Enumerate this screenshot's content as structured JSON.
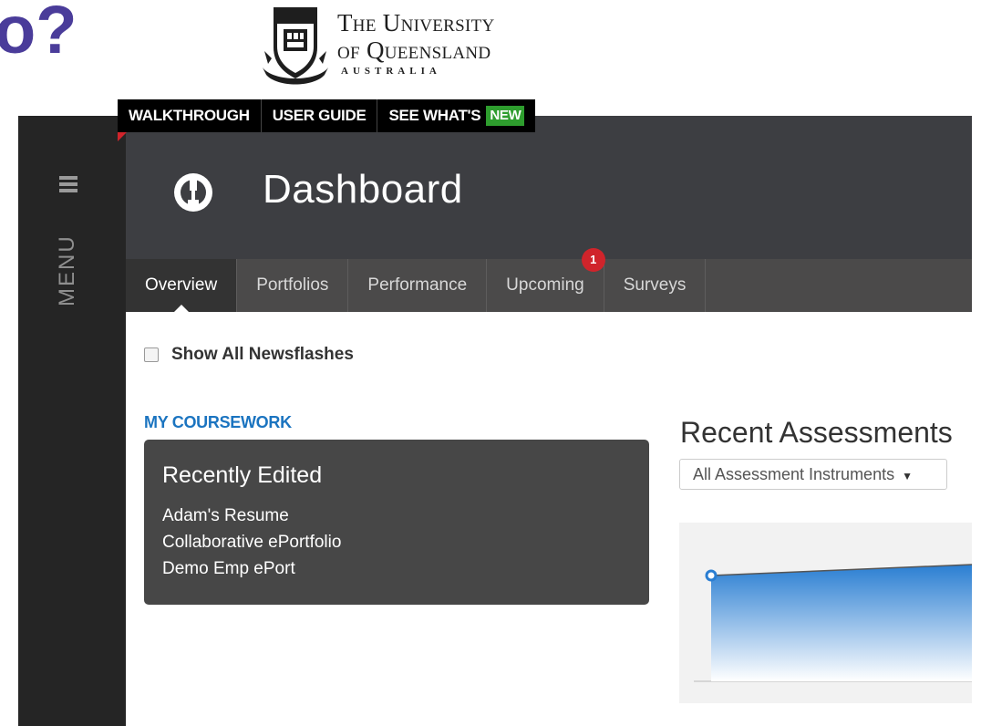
{
  "slide": {
    "title_fragment": "o?"
  },
  "university": {
    "line1": "The University",
    "line2": "of Queensland",
    "line3": "AUSTRALIA"
  },
  "topnav": {
    "walkthrough": "WALKTHROUGH",
    "user_guide": "USER GUIDE",
    "whats_new": "SEE WHAT'S",
    "new_badge": "NEW"
  },
  "sidebar": {
    "menu_label": "MENU"
  },
  "header": {
    "title": "Dashboard"
  },
  "tabs": [
    {
      "label": "Overview",
      "active": true
    },
    {
      "label": "Portfolios"
    },
    {
      "label": "Performance"
    },
    {
      "label": "Upcoming",
      "badge": "1"
    },
    {
      "label": "Surveys"
    }
  ],
  "newsflash": {
    "label": "Show All Newsflashes",
    "checked": false
  },
  "coursework": {
    "heading": "MY COURSEWORK",
    "card_title": "Recently Edited",
    "items": [
      "Adam's Resume",
      "Collaborative ePortfolio",
      "Demo Emp ePort"
    ]
  },
  "recent_assessments": {
    "title": "Recent Assessments",
    "filter": "All Assessment Instruments"
  },
  "colors": {
    "brand_purple": "#4a3c9a",
    "link_blue": "#1b74c0",
    "badge_red": "#d0242b",
    "new_green": "#2e9d2e",
    "chart_blue": "#2a7ed2"
  }
}
